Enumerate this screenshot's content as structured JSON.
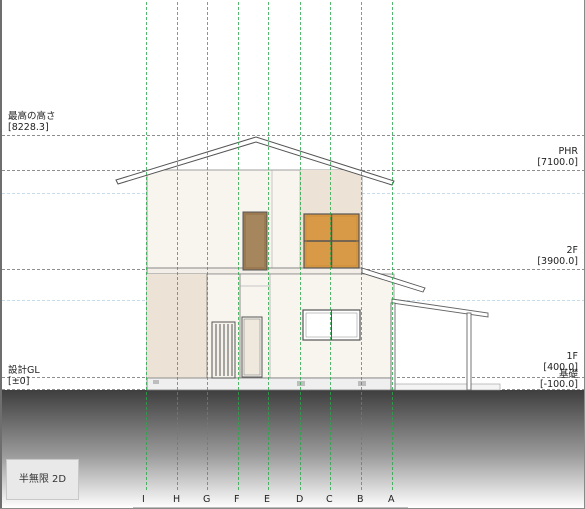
{
  "view": {
    "mode_label": "半無限 2D"
  },
  "levels": [
    {
      "name": "最高の高さ",
      "value": "[8228.3]"
    },
    {
      "name": "PHR",
      "value": "[7100.0]"
    },
    {
      "name": "2F",
      "value": "[3900.0]"
    },
    {
      "name": "1F",
      "value": "[400.0]"
    },
    {
      "name": "基礎",
      "value": "[-100.0]"
    },
    {
      "name": "設計GL",
      "value": "[±0]"
    }
  ],
  "grid_axes": [
    "I",
    "H",
    "G",
    "F",
    "E",
    "D",
    "C",
    "B",
    "A"
  ],
  "colors": {
    "grid_line": "#2aa84a",
    "level_line": "#6a6a6a",
    "wall": "#f8f5ef",
    "wall_shade": "#ece3d6",
    "window_glass": "#d89a46",
    "door": "#9b7a52",
    "ground_top": "#3e3e3e",
    "ground_bottom": "#ffffff"
  }
}
